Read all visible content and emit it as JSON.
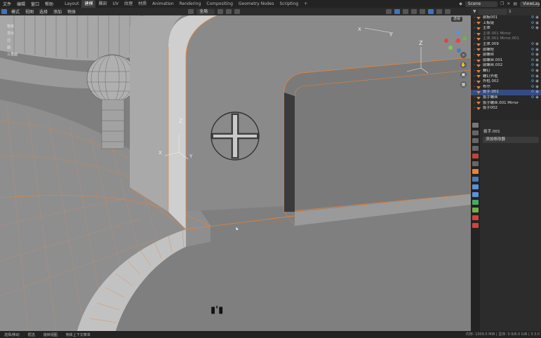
{
  "topbar": {
    "menus": [
      "文件",
      "编辑",
      "窗口",
      "帮助"
    ],
    "workspaces": [
      "Layout",
      "建模",
      "雕刻",
      "UV",
      "纹理",
      "材质",
      "Animation",
      "Rendering",
      "Compositing",
      "Geometry Nodes",
      "Scripting",
      "+"
    ],
    "active_workspace": "建模",
    "scene": "Scene",
    "view_layer": "ViewLaye"
  },
  "header": {
    "mode": "模式",
    "menus": [
      "视图",
      "选择",
      "添加",
      "物体"
    ],
    "transform": "全局"
  },
  "viewport": {
    "stats": [
      "物体",
      "顶点",
      "边",
      "面",
      "三角面",
      "",
      ""
    ],
    "hint": "透视",
    "status_symbol": "▮'▮",
    "axis": {
      "x": "X",
      "y": "Y",
      "z": "Z"
    }
  },
  "outliner": {
    "rows": [
      {
        "label": "前板001",
        "dim": false
      },
      {
        "label": "上板链",
        "dim": false
      },
      {
        "label": "主体",
        "dim": false
      },
      {
        "label": "主体.001 Mirror",
        "dim": true
      },
      {
        "label": "主体.001 Mirror.001",
        "dim": true
      },
      {
        "label": "主体.009",
        "dim": false
      },
      {
        "label": "前螺栓",
        "dim": false
      },
      {
        "label": "前螺丝",
        "dim": false
      },
      {
        "label": "前螺丝.001",
        "dim": false
      },
      {
        "label": "前螺丝.002",
        "dim": false
      },
      {
        "label": "螺钉",
        "dim": false
      },
      {
        "label": "螺钉外框",
        "dim": false
      },
      {
        "label": "外框.002",
        "dim": false
      },
      {
        "label": "布尔",
        "dim": false
      },
      {
        "label": "扳手.001",
        "dim": false,
        "selected": true
      },
      {
        "label": "扳手螺丝",
        "dim": false
      },
      {
        "label": "扳手螺丝.001 Mirror",
        "dim": false
      },
      {
        "label": "扳手002",
        "dim": false
      }
    ]
  },
  "properties": {
    "object": "扳手.001",
    "add_modifier": "添加修改器"
  },
  "statusbar": {
    "items": [
      "选择/移动",
      "框选",
      "旋转视图",
      "物体上下文菜单"
    ],
    "right": "内存: 1009.5 MiB | 显存: 0.9/8.0 GiB | 3.3.0"
  },
  "colors": {
    "accent": "#4772b3",
    "selection": "#e5843b",
    "viewport": "#7e7e7e"
  }
}
